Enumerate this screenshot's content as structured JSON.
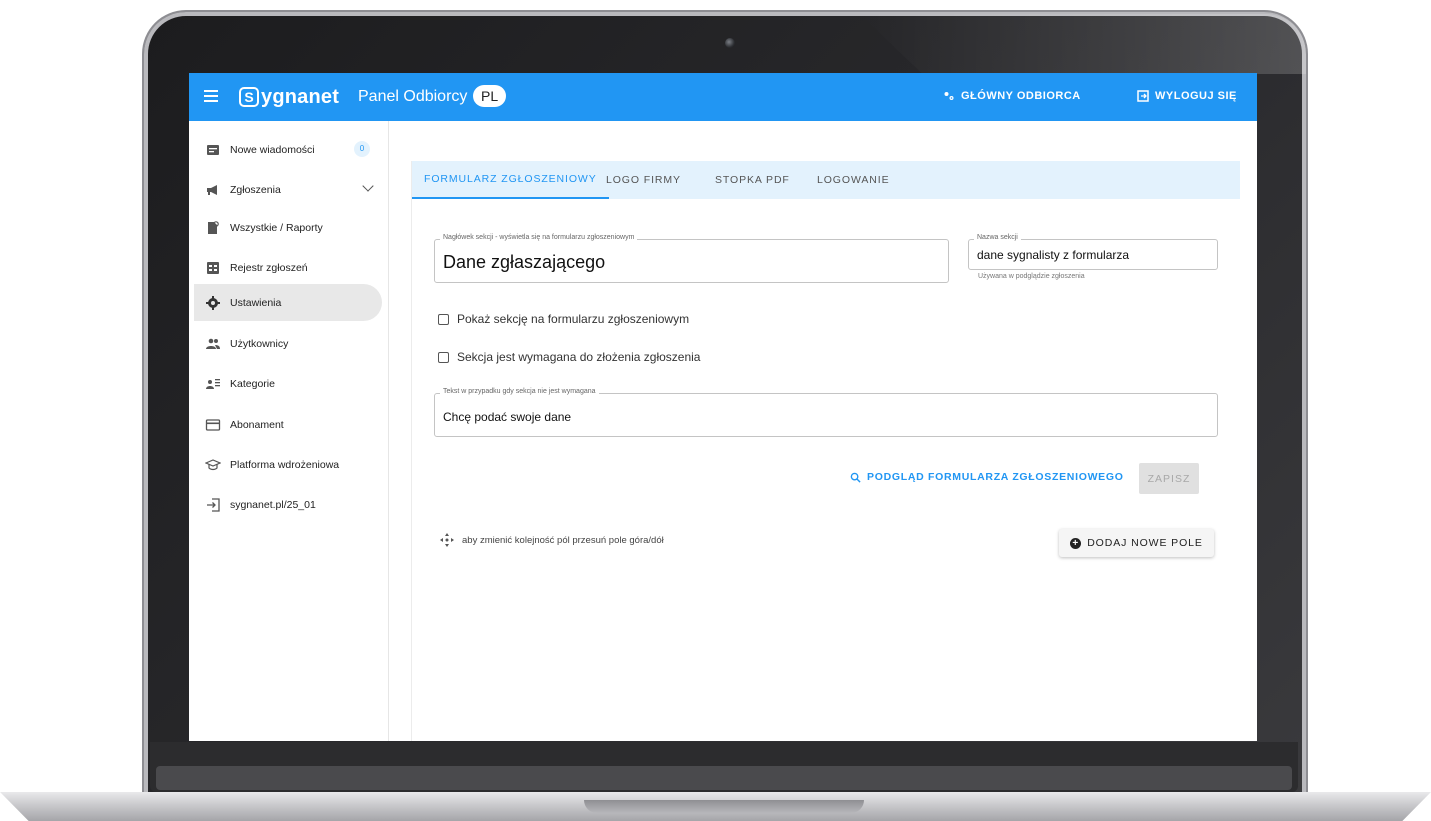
{
  "header": {
    "logo_initial": "S",
    "logo_text": "ygnanet",
    "panel_title": "Panel Odbiorcy",
    "language": "PL",
    "main_receiver": "GŁÓWNY ODBIORCA",
    "logout": "WYLOGUJ SIĘ"
  },
  "sidebar": {
    "items": [
      {
        "label": "Nowe wiadomości",
        "icon": "inbox-icon",
        "badge": "0"
      },
      {
        "label": "Zgłoszenia",
        "icon": "megaphone-icon"
      },
      {
        "label": "Wszystkie / Raporty",
        "icon": "report-search-icon"
      },
      {
        "label": "Rejestr zgłoszeń",
        "icon": "register-icon"
      },
      {
        "label": "Ustawienia",
        "icon": "gear-icon",
        "active": true
      },
      {
        "label": "Użytkownicy",
        "icon": "users-icon"
      },
      {
        "label": "Kategorie",
        "icon": "categories-icon"
      },
      {
        "label": "Abonament",
        "icon": "card-icon"
      },
      {
        "label": "Platforma wdrożeniowa",
        "icon": "graduation-cap-icon"
      },
      {
        "label": "sygnanet.pl/25_01",
        "icon": "login-icon"
      }
    ]
  },
  "tabs": [
    {
      "label": "FORMULARZ ZGŁOSZENIOWY",
      "active": true
    },
    {
      "label": "LOGO FIRMY"
    },
    {
      "label": "STOPKA PDF"
    },
    {
      "label": "LOGOWANIE"
    }
  ],
  "form": {
    "section_header_legend": "Nagłówek sekcji - wyświetla się na formularzu zgłoszeniowym",
    "section_header_value": "Dane zgłaszającego",
    "section_name_legend": "Nazwa sekcji",
    "section_name_value": "dane sygnalisty z formularza",
    "section_name_help": "Używana w podglądzie zgłoszenia",
    "show_section_label": "Pokaż sekcję na formularzu zgłoszeniowym",
    "required_section_label": "Sekcja jest wymagana do złożenia zgłoszenia",
    "optional_text_legend": "Tekst w przypadku gdy sekcja nie jest wymagana",
    "optional_text_value": "Chcę podać swoje dane",
    "preview_label": "PODGLĄD FORMULARZA ZGŁOSZENIOWEGO",
    "save_label": "ZAPISZ",
    "reorder_hint": "aby zmienić kolejność pól przesuń pole góra/dół",
    "add_field_label": "DODAJ NOWE POLE"
  },
  "colors": {
    "brand": "#2196f3",
    "tab_bar": "#e3f2fd",
    "active_nav": "#e8e8e8"
  }
}
